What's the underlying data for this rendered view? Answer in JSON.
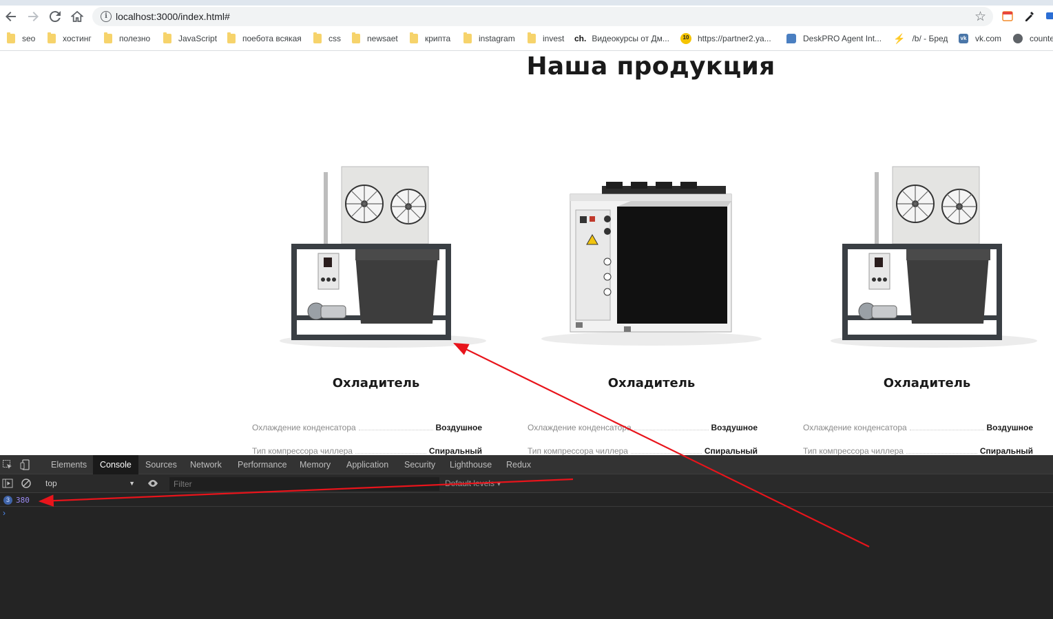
{
  "browser": {
    "url": "localhost:3000/index.html#",
    "bookmarks": [
      {
        "label": "seo",
        "type": "folder"
      },
      {
        "label": "хостинг",
        "type": "folder"
      },
      {
        "label": "полезно",
        "type": "folder"
      },
      {
        "label": "JavaScript",
        "type": "folder"
      },
      {
        "label": "поебота всякая",
        "type": "folder"
      },
      {
        "label": "css",
        "type": "folder"
      },
      {
        "label": "newsaet",
        "type": "folder"
      },
      {
        "label": "крипта",
        "type": "folder"
      },
      {
        "label": "instagram",
        "type": "folder"
      },
      {
        "label": "invest",
        "type": "folder"
      },
      {
        "label": "Видеокурсы от Дм...",
        "type": "ch"
      },
      {
        "label": "https://partner2.ya...",
        "type": "ya"
      },
      {
        "label": "DeskPRO Agent Int...",
        "type": "desk"
      },
      {
        "label": "/b/ - Бред",
        "type": "bolt"
      },
      {
        "label": "vk.com",
        "type": "vk"
      },
      {
        "label": "counte",
        "type": "globe"
      }
    ],
    "bookmark_prefix_ch": "ch.",
    "ya_badge": "10"
  },
  "page": {
    "title": "Наша продукция",
    "products": [
      {
        "title": "Охладитель",
        "image": "chiller-frame",
        "specs": [
          {
            "label": "Охлаждение конденсатора",
            "value": "Воздушное"
          },
          {
            "label": "Тип компрессора чиллера",
            "value": "Спиральный"
          }
        ]
      },
      {
        "title": "Охладитель",
        "image": "chiller-box",
        "specs": [
          {
            "label": "Охлаждение конденсатора",
            "value": "Воздушное"
          },
          {
            "label": "Тип компрессора чиллера",
            "value": "Спиральный"
          }
        ]
      },
      {
        "title": "Охладитель",
        "image": "chiller-frame",
        "specs": [
          {
            "label": "Охлаждение конденсатора",
            "value": "Воздушное"
          },
          {
            "label": "Тип компрессора чиллера",
            "value": "Спиральный"
          }
        ]
      }
    ]
  },
  "devtools": {
    "tabs": [
      "Elements",
      "Console",
      "Sources",
      "Network",
      "Performance",
      "Memory",
      "Application",
      "Security",
      "Lighthouse",
      "Redux"
    ],
    "active_tab": "Console",
    "context": "top",
    "filter_placeholder": "Filter",
    "levels": "Default levels ▾",
    "log": {
      "count": "3",
      "value": "380"
    },
    "prompt": "›"
  },
  "colors": {
    "annotation_arrow": "#e8141b",
    "devtools_bg": "#242424",
    "log_value": "#9c8cf5"
  }
}
